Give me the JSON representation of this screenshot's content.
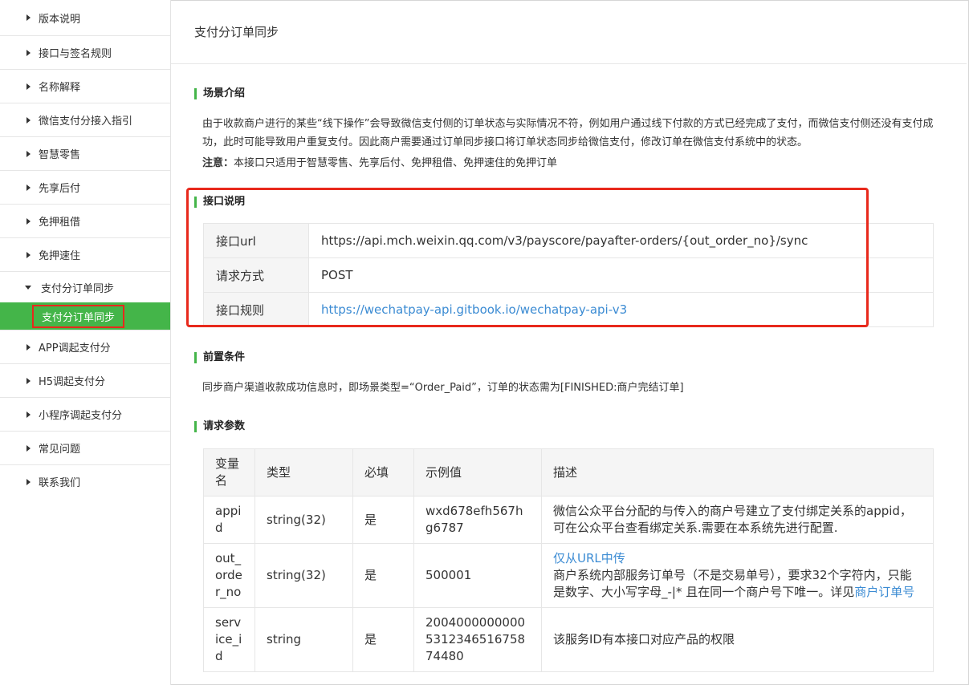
{
  "sidebar": {
    "items": [
      {
        "label": "版本说明"
      },
      {
        "label": "接口与签名规则"
      },
      {
        "label": "名称解释"
      },
      {
        "label": "微信支付分接入指引"
      },
      {
        "label": "智慧零售"
      },
      {
        "label": "先享后付"
      },
      {
        "label": "免押租借"
      },
      {
        "label": "免押速住"
      },
      {
        "label": "支付分订单同步"
      }
    ],
    "active_sub": "支付分订单同步",
    "items_after": [
      {
        "label": "APP调起支付分"
      },
      {
        "label": "H5调起支付分"
      },
      {
        "label": "小程序调起支付分"
      },
      {
        "label": "常见问题"
      },
      {
        "label": "联系我们"
      }
    ]
  },
  "main": {
    "title": "支付分订单同步",
    "scene": {
      "heading": "场景介绍",
      "text": "由于收款商户进行的某些“线下操作”会导致微信支付侧的订单状态与实际情况不符，例如用户通过线下付款的方式已经完成了支付，而微信支付侧还没有支付成功，此时可能导致用户重复支付。因此商户需要通过订单同步接口将订单状态同步给微信支付，修改订单在微信支付系统中的状态。",
      "note_label": "注意：",
      "note_text": "本接口只适用于智慧零售、先享后付、免押租借、免押速住的免押订单"
    },
    "api": {
      "heading": "接口说明",
      "url_label": "接口url",
      "url_value": "https://api.mch.weixin.qq.com/v3/payscore/payafter-orders/{out_order_no}/sync",
      "method_label": "请求方式",
      "method_value": "POST",
      "rule_label": "接口规则",
      "rule_value": "https://wechatpay-api.gitbook.io/wechatpay-api-v3"
    },
    "precondition": {
      "heading": "前置条件",
      "text": "同步商户渠道收款成功信息时，即场景类型=“Order_Paid”，订单的状态需为[FINISHED:商户完结订单]"
    },
    "params": {
      "heading": "请求参数",
      "columns": [
        "变量名",
        "类型",
        "必填",
        "示例值",
        "描述"
      ],
      "rows": [
        {
          "name": "appid",
          "type": "string(32)",
          "required": "是",
          "example": "wxd678efh567hg6787",
          "desc": "微信公众平台分配的与传入的商户号建立了支付绑定关系的appid，可在公众平台查看绑定关系.需要在本系统先进行配置."
        },
        {
          "name": "out_order_no",
          "type": "string(32)",
          "required": "是",
          "example": "500001",
          "desc_link": "仅从URL中传",
          "desc": "商户系统内部服务订单号（不是交易单号），要求32个字符内，只能是数字、大小写字母_-|* 且在同一个商户号下唯一。详见",
          "desc_link2": "商户订单号"
        },
        {
          "name": "service_id",
          "type": "string",
          "required": "是",
          "example": "2004000000000531234651675874480",
          "desc": "该服务ID有本接口对应产品的权限"
        }
      ]
    }
  }
}
